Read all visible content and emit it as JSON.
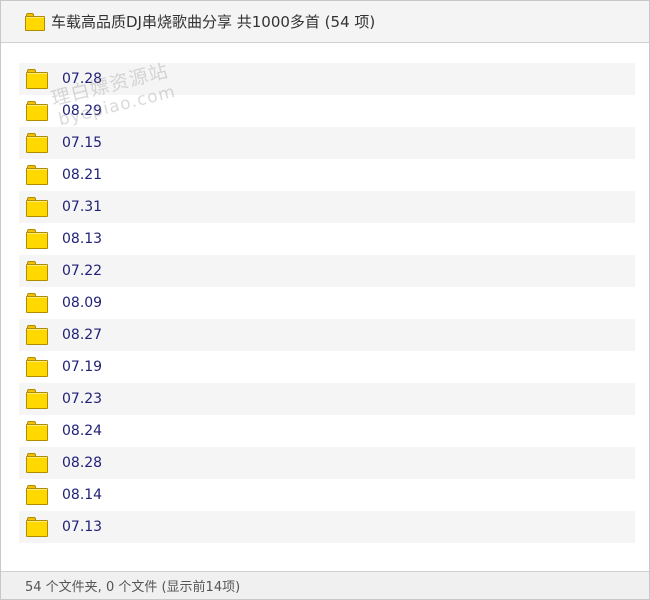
{
  "header": {
    "icon": "folder-icon",
    "title": "车载高品质DJ串烧歌曲分享 共1000多首 (54 项)"
  },
  "items": [
    {
      "label": "07.28",
      "icon": "folder-icon"
    },
    {
      "label": "08.29",
      "icon": "folder-icon"
    },
    {
      "label": "07.15",
      "icon": "folder-icon"
    },
    {
      "label": "08.21",
      "icon": "folder-icon"
    },
    {
      "label": "07.31",
      "icon": "folder-icon"
    },
    {
      "label": "08.13",
      "icon": "folder-icon"
    },
    {
      "label": "07.22",
      "icon": "folder-icon"
    },
    {
      "label": "08.09",
      "icon": "folder-icon"
    },
    {
      "label": "08.27",
      "icon": "folder-icon"
    },
    {
      "label": "07.19",
      "icon": "folder-icon"
    },
    {
      "label": "07.23",
      "icon": "folder-icon"
    },
    {
      "label": "08.24",
      "icon": "folder-icon"
    },
    {
      "label": "08.28",
      "icon": "folder-icon"
    },
    {
      "label": "08.14",
      "icon": "folder-icon"
    },
    {
      "label": "07.13",
      "icon": "folder-icon"
    }
  ],
  "watermark": {
    "line1": "理白嫖资源站",
    "line2": "byepiao.com"
  },
  "footer": {
    "status": "54 个文件夹, 0 个文件 (显示前14项)"
  },
  "colors": {
    "folder": "#ffd800",
    "link": "#1f1f78",
    "row_alt": "#f5f5f5"
  }
}
